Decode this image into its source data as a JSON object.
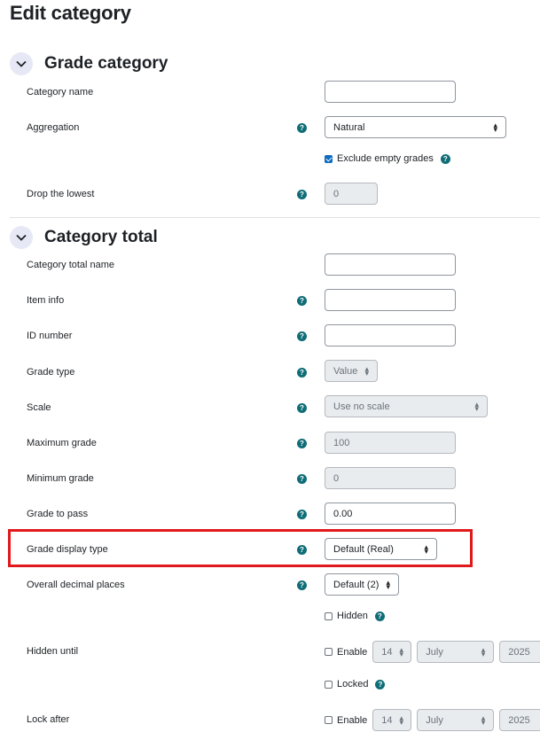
{
  "page": {
    "title": "Edit category"
  },
  "grade_category": {
    "heading": "Grade category",
    "category_name_label": "Category name",
    "category_name_value": "",
    "aggregation_label": "Aggregation",
    "aggregation_value": "Natural",
    "exclude_empty_label": "Exclude empty grades",
    "exclude_empty_checked": true,
    "drop_lowest_label": "Drop the lowest",
    "drop_lowest_value": "0"
  },
  "category_total": {
    "heading": "Category total",
    "total_name_label": "Category total name",
    "total_name_value": "",
    "item_info_label": "Item info",
    "item_info_value": "",
    "id_number_label": "ID number",
    "id_number_value": "",
    "grade_type_label": "Grade type",
    "grade_type_value": "Value",
    "scale_label": "Scale",
    "scale_value": "Use no scale",
    "max_grade_label": "Maximum grade",
    "max_grade_value": "100",
    "min_grade_label": "Minimum grade",
    "min_grade_value": "0",
    "grade_pass_label": "Grade to pass",
    "grade_pass_value": "0.00",
    "display_type_label": "Grade display type",
    "display_type_value": "Default (Real)",
    "decimal_label": "Overall decimal places",
    "decimal_value": "Default (2)",
    "hidden_label": "Hidden",
    "hidden_until_label": "Hidden until",
    "hidden_until_enable": "Enable",
    "hidden_until_day": "14",
    "hidden_until_month": "July",
    "hidden_until_year": "2025",
    "locked_label": "Locked",
    "lock_after_label": "Lock after",
    "lock_after_enable": "Enable",
    "lock_after_day": "14",
    "lock_after_month": "July",
    "lock_after_year": "2025"
  },
  "icons": {
    "help": "question-circle-icon",
    "collapse": "chevron-down-icon"
  },
  "colors": {
    "help": "#0f6d77",
    "highlight": "#e0191c",
    "checkbox": "#0f6cbf"
  }
}
